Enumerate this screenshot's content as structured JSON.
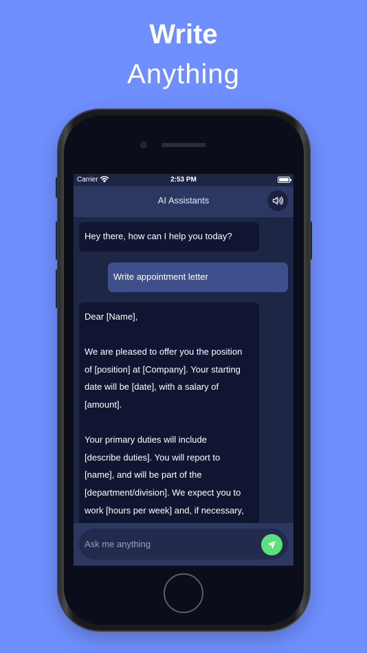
{
  "promo": {
    "headline_bold": "Write",
    "headline_light": "Anything"
  },
  "status_bar": {
    "carrier": "Carrier",
    "time": "2:53 PM"
  },
  "nav": {
    "title": "AI Assistants",
    "speaker_icon": "speaker-volume-icon"
  },
  "messages": [
    {
      "role": "assistant",
      "text": "Hey there, how can I help you today?"
    },
    {
      "role": "user",
      "text": "Write appointment letter"
    },
    {
      "role": "assistant",
      "paragraphs": [
        [
          "Dear [Name],"
        ],
        [
          "We are pleased to offer you the position",
          "of [position] at [Company]. Your starting",
          "date will be [date], with a salary of",
          "[amount]."
        ],
        [
          "Your primary duties will include",
          "[describe duties]. You will report to",
          "[name], and will be part of the",
          "[department/division]. We expect you to",
          "work [hours per week] and, if necessary,"
        ]
      ]
    }
  ],
  "composer": {
    "placeholder": "Ask me anything",
    "value": "",
    "send_icon": "paper-plane-icon"
  },
  "colors": {
    "background": "#6f8ffe",
    "nav_bar": "#2c3862",
    "user_bubble": "#3e4f8c",
    "assistant_bubble": "#101631",
    "send_button": "#5ce07a"
  }
}
